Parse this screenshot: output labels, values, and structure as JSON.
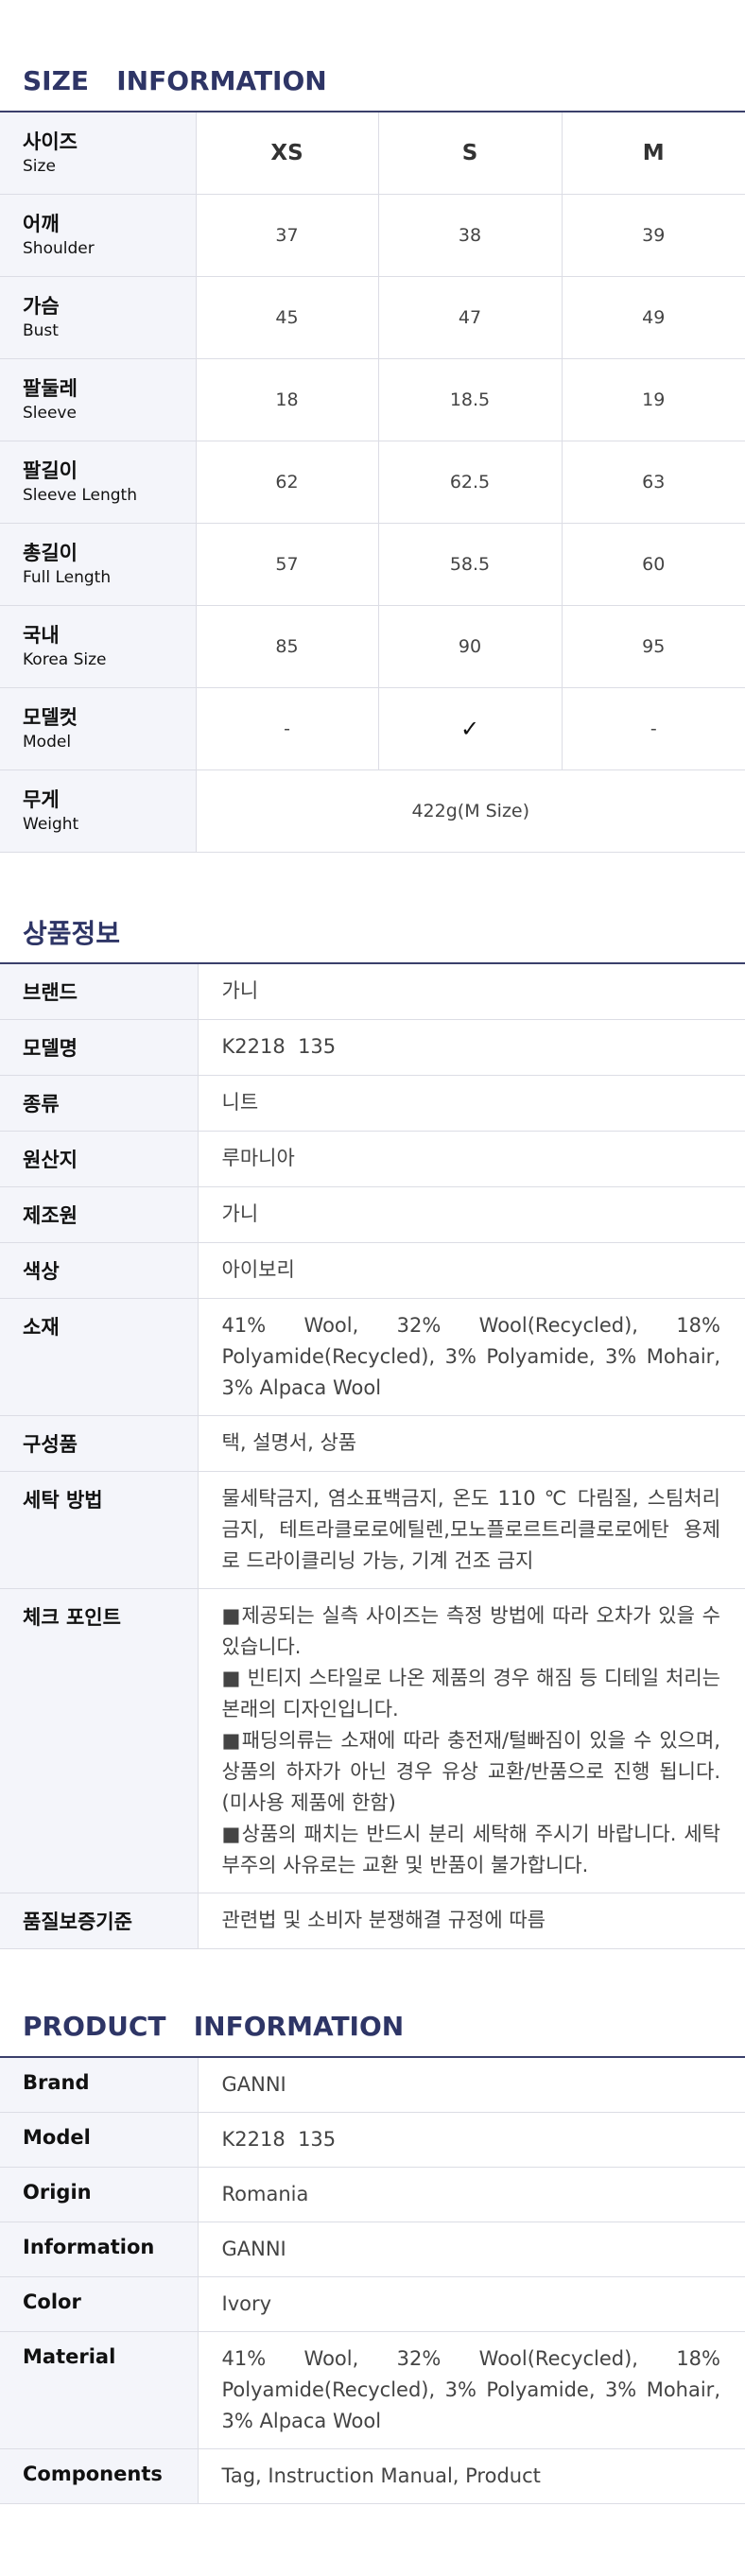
{
  "size_info": {
    "title": "SIZE   INFORMATION",
    "header": {
      "label_ko": "사이즈",
      "label_en": "Size",
      "sizes": [
        "XS",
        "S",
        "M"
      ]
    },
    "rows": [
      {
        "ko": "어깨",
        "en": "Shoulder",
        "values": [
          "37",
          "38",
          "39"
        ]
      },
      {
        "ko": "가슴",
        "en": "Bust",
        "values": [
          "45",
          "47",
          "49"
        ]
      },
      {
        "ko": "팔둘레",
        "en": "Sleeve",
        "values": [
          "18",
          "18.5",
          "19"
        ]
      },
      {
        "ko": "팔길이",
        "en": "Sleeve Length",
        "values": [
          "62",
          "62.5",
          "63"
        ]
      },
      {
        "ko": "총길이",
        "en": "Full Length",
        "values": [
          "57",
          "58.5",
          "60"
        ]
      },
      {
        "ko": "국내",
        "en": "Korea Size",
        "values": [
          "85",
          "90",
          "95"
        ]
      },
      {
        "ko": "모델컷",
        "en": "Model",
        "values": [
          "-",
          "✓",
          "-"
        ]
      }
    ],
    "weight": {
      "ko": "무게",
      "en": "Weight",
      "value": "422g(M Size)"
    }
  },
  "product_info_ko": {
    "title": "상품정보",
    "rows": [
      {
        "key": "브랜드",
        "value": "가니"
      },
      {
        "key": "모델명",
        "value": "K2218  135"
      },
      {
        "key": "종류",
        "value": "니트"
      },
      {
        "key": "원산지",
        "value": "루마니아"
      },
      {
        "key": "제조원",
        "value": "가니"
      },
      {
        "key": "색상",
        "value": "아이보리"
      },
      {
        "key": "소재",
        "value": "41% Wool, 32% Wool(Recycled), 18% Polyamide(Recycled), 3% Polyamide, 3% Mohair, 3% Alpaca Wool"
      },
      {
        "key": "구성품",
        "value": "택, 설명서, 상품"
      },
      {
        "key": "세탁 방법",
        "value": "물세탁금지, 염소표백금지, 온도 110 ℃ 다림질, 스팀처리 금지, 테트라클로로에틸렌,모노플로르트리클로로에탄 용제로 드라이클리닝 가능, 기계 건조 금지"
      }
    ],
    "check_point": {
      "key": "체크 포인트",
      "items": [
        " ■제공되는 실측 사이즈는 측정 방법에 따라 오차가 있을 수 있습니다.",
        " ■ 빈티지 스타일로 나온 제품의 경우 해짐 등 디테일 처리는 본래의 디자인입니다.",
        " ■패딩의류는 소재에 따라 충전재/털빠짐이 있을 수 있으며, 상품의 하자가 아닌 경우 유상 교환/반품으로 진행 됩니다.(미사용 제품에 한함)",
        " ■상품의 패치는 반드시 분리 세탁해 주시기 바랍니다. 세탁 부주의 사유로는 교환 및 반품이 불가합니다."
      ]
    },
    "warranty": {
      "key": "품질보증기준",
      "value": "관련법 및 소비자 분쟁해결 규정에 따름"
    }
  },
  "product_info_en": {
    "title": "PRODUCT   INFORMATION",
    "rows": [
      {
        "key": "Brand",
        "value": "GANNI"
      },
      {
        "key": "Model",
        "value": "K2218  135"
      },
      {
        "key": "Origin",
        "value": "Romania"
      },
      {
        "key": "Information",
        "value": "GANNI"
      },
      {
        "key": "Color",
        "value": "Ivory"
      },
      {
        "key": "Material",
        "value": "41% Wool, 32% Wool(Recycled), 18% Polyamide(Recycled), 3% Polyamide, 3% Mohair, 3% Alpaca Wool"
      },
      {
        "key": "Components",
        "value": "Tag, Instruction Manual, Product"
      }
    ]
  }
}
